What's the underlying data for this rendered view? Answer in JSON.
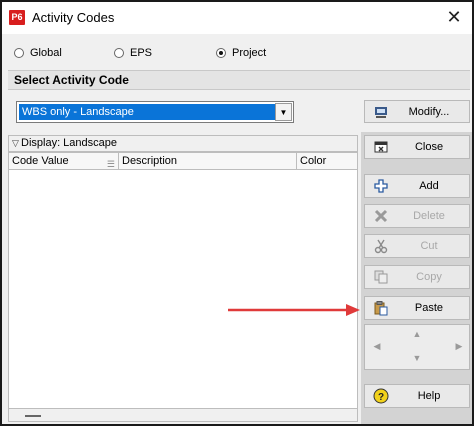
{
  "window": {
    "title": "Activity Codes",
    "app_icon_text": "P6",
    "close_glyph": "✕"
  },
  "scope": {
    "options": [
      {
        "label": "Global",
        "selected": false
      },
      {
        "label": "EPS",
        "selected": false
      },
      {
        "label": "Project",
        "selected": true
      }
    ]
  },
  "select_section": {
    "header": "Select Activity Code"
  },
  "dropdown": {
    "value": "WBS only - Landscape"
  },
  "buttons": {
    "modify": "Modify...",
    "close": "Close",
    "add": "Add",
    "delete": "Delete",
    "cut": "Cut",
    "copy": "Copy",
    "paste": "Paste",
    "help": "Help"
  },
  "display": {
    "label": "Display: Landscape"
  },
  "grid": {
    "columns": [
      "Code Value",
      "Description",
      "Color"
    ],
    "rows": []
  },
  "colors": {
    "selection": "#0a74d8",
    "annotation_arrow": "#e03a3a",
    "app_icon": "#d81e1e"
  }
}
